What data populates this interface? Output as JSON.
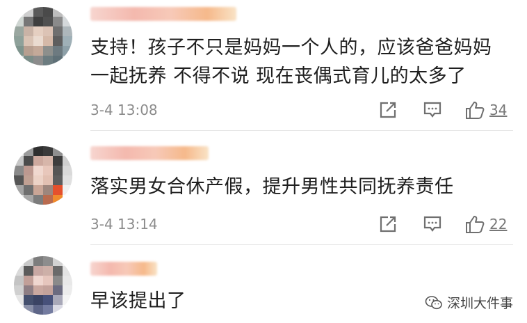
{
  "comments": [
    {
      "text_lines": [
        "支持！孩子不只是妈妈一个人的，应该爸爸妈妈",
        "一起抚养 不得不说 现在丧偶式育儿的太多了"
      ],
      "time": "3-4 13:08",
      "likes": "34",
      "share_icon": "share-icon",
      "comment_icon": "comment-icon",
      "like_icon": "thumbs-up-icon"
    },
    {
      "text_lines": [
        "落实男女合休产假，提升男性共同抚养责任"
      ],
      "time": "3-4 13:14",
      "likes": "22",
      "share_icon": "share-icon",
      "comment_icon": "comment-icon",
      "like_icon": "thumbs-up-icon"
    },
    {
      "text_lines": [
        "早该提出了"
      ]
    }
  ],
  "watermark": {
    "label": "深圳大件事",
    "icon": "wechat-icon"
  },
  "colors": {
    "text": "#1f1f1f",
    "meta": "#8c8c8c",
    "divider": "#e6e6e6",
    "username_blur": "#f4b9ae"
  }
}
